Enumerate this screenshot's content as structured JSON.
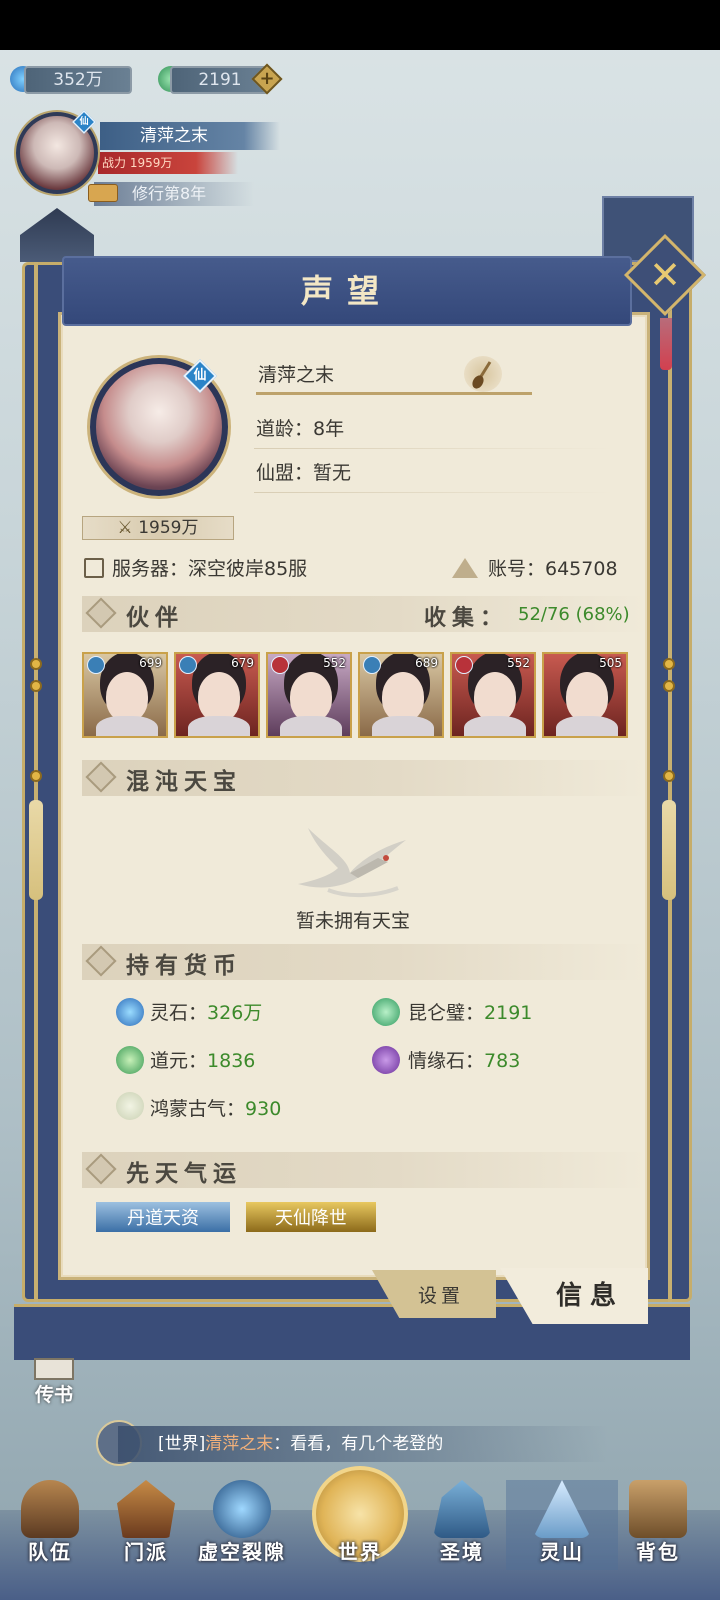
{
  "resources": {
    "spirit_stone": "352万",
    "jade": "2191",
    "add_icon": "plus-icon"
  },
  "player": {
    "name": "清萍之末",
    "power": "战力 1959万",
    "cultivation": "修行第8年",
    "badge": "仙"
  },
  "panel": {
    "title": "声望",
    "profile": {
      "name": "清萍之末",
      "dao_age": "道龄：8年",
      "alliance": "仙盟：暂无",
      "power_tag": "1959万",
      "server": "服务器：深空彼岸85服",
      "account": "账号：645708"
    },
    "companions": {
      "title": "伙伴",
      "collect_label": "收集：",
      "collect_value": "52/76 (68%)",
      "cards": [
        {
          "level": "699"
        },
        {
          "level": "679"
        },
        {
          "level": "552"
        },
        {
          "level": "689"
        },
        {
          "level": "552"
        },
        {
          "level": "505"
        }
      ]
    },
    "treasure": {
      "title": "混沌天宝",
      "empty_text": "暂未拥有天宝"
    },
    "currency": {
      "title": "持有货币",
      "items": [
        {
          "label": "灵石：",
          "value": "326万"
        },
        {
          "label": "昆仑璧：",
          "value": "2191"
        },
        {
          "label": "道元：",
          "value": "1836"
        },
        {
          "label": "情缘石：",
          "value": "783"
        },
        {
          "label": "鸿蒙古气：",
          "value": "930"
        }
      ]
    },
    "fortune": {
      "title": "先天气运",
      "tags": [
        "丹道天资",
        "天仙降世"
      ]
    },
    "tabs": {
      "settings": "设置",
      "info": "信息"
    }
  },
  "side": {
    "letter": "传书"
  },
  "chat": {
    "channel": "[世界]",
    "sender": "清萍之末",
    "message": "：看看，有几个老登的"
  },
  "nav": {
    "items": [
      "队伍",
      "门派",
      "虚空裂隙",
      "世界",
      "圣境",
      "灵山",
      "背包"
    ]
  },
  "colors": {
    "accent_green": "#3c8a2b",
    "frame_blue": "#3a4d79",
    "gold": "#c6ad6a"
  }
}
